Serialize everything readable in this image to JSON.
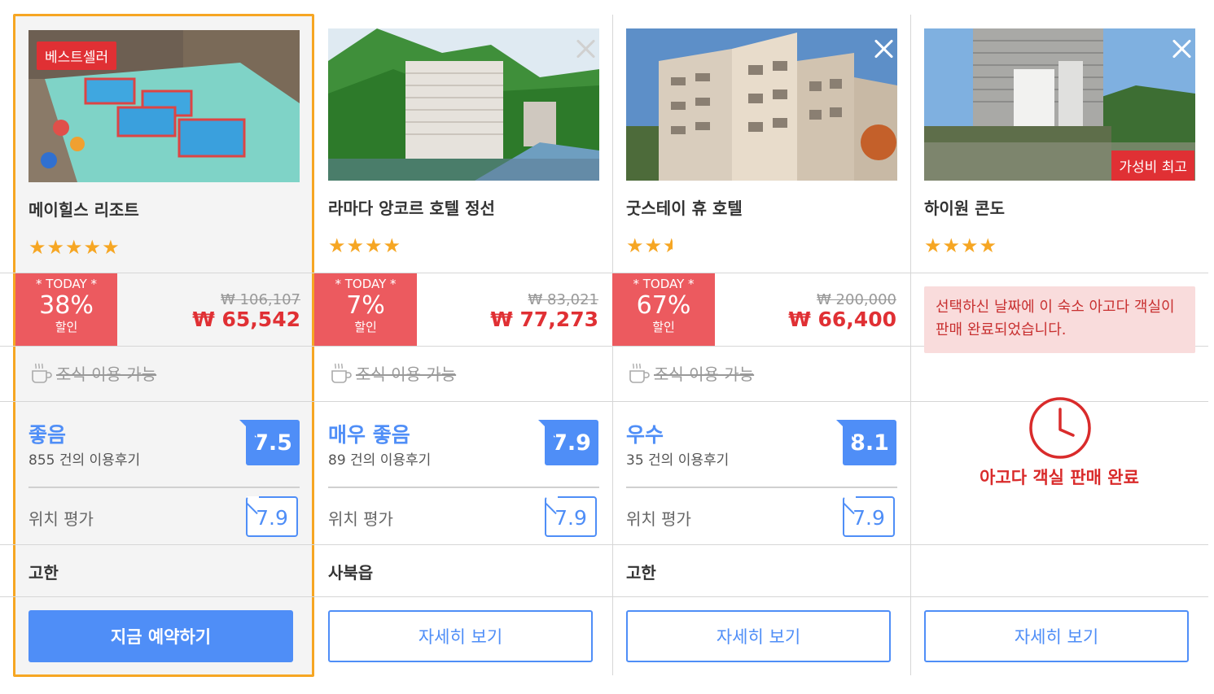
{
  "colors": {
    "accent_blue": "#4f8ef7",
    "sale_red": "#ec5a5f",
    "price_red": "#e03034",
    "star_orange": "#f6a623",
    "featured_border": "#f6a623"
  },
  "hotels": [
    {
      "badge": "베스트셀러",
      "name": "메이힐스 리조트",
      "stars": 5,
      "today_label": "* TODAY *",
      "discount": "38%",
      "discount_label": "할인",
      "price_old": "₩ 106,107",
      "price_new": "₩ 65,542",
      "breakfast": "조식 이용 가능",
      "review_word": "좋음",
      "review_count": "855 건의 이용후기",
      "score": "7.5",
      "location_label": "위치 평가",
      "location_score": "7.9",
      "area": "고한",
      "button": "지금 예약하기"
    },
    {
      "name": "라마다 앙코르 호텔 정선",
      "stars": 4,
      "today_label": "* TODAY *",
      "discount": "7%",
      "discount_label": "할인",
      "price_old": "₩ 83,021",
      "price_new": "₩ 77,273",
      "breakfast": "조식 이용 가능",
      "review_word": "매우 좋음",
      "review_count": "89 건의 이용후기",
      "score": "7.9",
      "location_label": "위치 평가",
      "location_score": "7.9",
      "area": "사북읍",
      "button": "자세히 보기"
    },
    {
      "name": "굿스테이 휴 호텔",
      "stars": 2.5,
      "today_label": "* TODAY *",
      "discount": "67%",
      "discount_label": "할인",
      "price_old": "₩ 200,000",
      "price_new": "₩ 66,400",
      "breakfast": "조식 이용 가능",
      "review_word": "우수",
      "review_count": "35 건의 이용후기",
      "score": "8.1",
      "location_label": "위치 평가",
      "location_score": "7.9",
      "area": "고한",
      "button": "자세히 보기"
    },
    {
      "badge": "가성비 최고",
      "name": "하이원 콘도",
      "stars": 4,
      "soldout_message": "선택하신 날짜에 이 숙소 아고다 객실이 판매 완료되었습니다.",
      "soldout_title": "아고다 객실 판매 완료",
      "button": "자세히 보기"
    }
  ],
  "stars_glyphs": {
    "five": "★★★★★",
    "four": "★★★★",
    "two": "★★",
    "half": "★"
  }
}
